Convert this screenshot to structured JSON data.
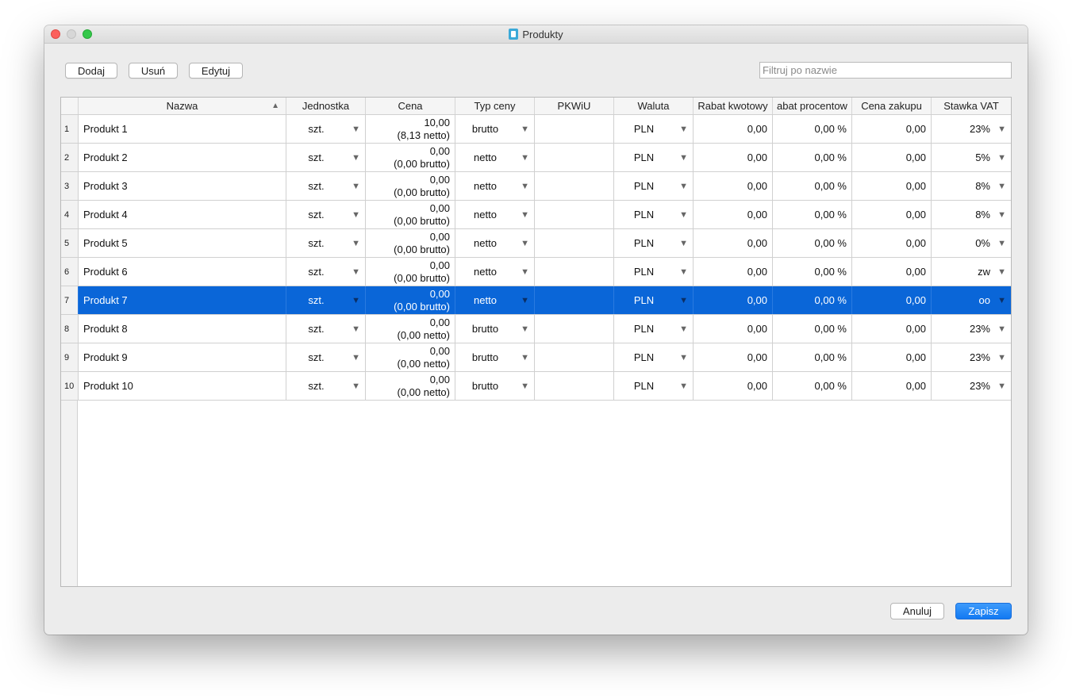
{
  "window": {
    "title": "Produkty"
  },
  "toolbar": {
    "add_label": "Dodaj",
    "remove_label": "Usuń",
    "edit_label": "Edytuj",
    "filter_placeholder": "Filtruj po nazwie"
  },
  "table": {
    "columns": [
      "Nazwa",
      "Jednostka",
      "Cena",
      "Typ ceny",
      "PKWiU",
      "Waluta",
      "Rabat kwotowy",
      "abat procentow",
      "Cena zakupu",
      "Stawka VAT"
    ],
    "sort_indicator": "▲",
    "dropdown_arrow": "▼",
    "selected_row": 7,
    "rows": [
      {
        "num": "1",
        "name": "Produkt 1",
        "unit": "szt.",
        "price": "10,00",
        "price_sub": "(8,13 netto)",
        "price_type": "brutto",
        "pkwiu": "",
        "currency": "PLN",
        "discount_amount": "0,00",
        "discount_percent": "0,00 %",
        "purchase_price": "0,00",
        "vat": "23%"
      },
      {
        "num": "2",
        "name": "Produkt 2",
        "unit": "szt.",
        "price": "0,00",
        "price_sub": "(0,00 brutto)",
        "price_type": "netto",
        "pkwiu": "",
        "currency": "PLN",
        "discount_amount": "0,00",
        "discount_percent": "0,00 %",
        "purchase_price": "0,00",
        "vat": "5%"
      },
      {
        "num": "3",
        "name": "Produkt 3",
        "unit": "szt.",
        "price": "0,00",
        "price_sub": "(0,00 brutto)",
        "price_type": "netto",
        "pkwiu": "",
        "currency": "PLN",
        "discount_amount": "0,00",
        "discount_percent": "0,00 %",
        "purchase_price": "0,00",
        "vat": "8%"
      },
      {
        "num": "4",
        "name": "Produkt 4",
        "unit": "szt.",
        "price": "0,00",
        "price_sub": "(0,00 brutto)",
        "price_type": "netto",
        "pkwiu": "",
        "currency": "PLN",
        "discount_amount": "0,00",
        "discount_percent": "0,00 %",
        "purchase_price": "0,00",
        "vat": "8%"
      },
      {
        "num": "5",
        "name": "Produkt 5",
        "unit": "szt.",
        "price": "0,00",
        "price_sub": "(0,00 brutto)",
        "price_type": "netto",
        "pkwiu": "",
        "currency": "PLN",
        "discount_amount": "0,00",
        "discount_percent": "0,00 %",
        "purchase_price": "0,00",
        "vat": "0%"
      },
      {
        "num": "6",
        "name": "Produkt 6",
        "unit": "szt.",
        "price": "0,00",
        "price_sub": "(0,00 brutto)",
        "price_type": "netto",
        "pkwiu": "",
        "currency": "PLN",
        "discount_amount": "0,00",
        "discount_percent": "0,00 %",
        "purchase_price": "0,00",
        "vat": "zw"
      },
      {
        "num": "7",
        "name": "Produkt 7",
        "unit": "szt.",
        "price": "0,00",
        "price_sub": "(0,00 brutto)",
        "price_type": "netto",
        "pkwiu": "",
        "currency": "PLN",
        "discount_amount": "0,00",
        "discount_percent": "0,00 %",
        "purchase_price": "0,00",
        "vat": "oo"
      },
      {
        "num": "8",
        "name": "Produkt 8",
        "unit": "szt.",
        "price": "0,00",
        "price_sub": "(0,00 netto)",
        "price_type": "brutto",
        "pkwiu": "",
        "currency": "PLN",
        "discount_amount": "0,00",
        "discount_percent": "0,00 %",
        "purchase_price": "0,00",
        "vat": "23%"
      },
      {
        "num": "9",
        "name": "Produkt 9",
        "unit": "szt.",
        "price": "0,00",
        "price_sub": "(0,00 netto)",
        "price_type": "brutto",
        "pkwiu": "",
        "currency": "PLN",
        "discount_amount": "0,00",
        "discount_percent": "0,00 %",
        "purchase_price": "0,00",
        "vat": "23%"
      },
      {
        "num": "10",
        "name": "Produkt 10",
        "unit": "szt.",
        "price": "0,00",
        "price_sub": "(0,00 netto)",
        "price_type": "brutto",
        "pkwiu": "",
        "currency": "PLN",
        "discount_amount": "0,00",
        "discount_percent": "0,00 %",
        "purchase_price": "0,00",
        "vat": "23%"
      }
    ]
  },
  "footer": {
    "cancel_label": "Anuluj",
    "save_label": "Zapisz"
  },
  "colors": {
    "selection": "#0a66d8",
    "primary_button": "#1a7ff5"
  }
}
